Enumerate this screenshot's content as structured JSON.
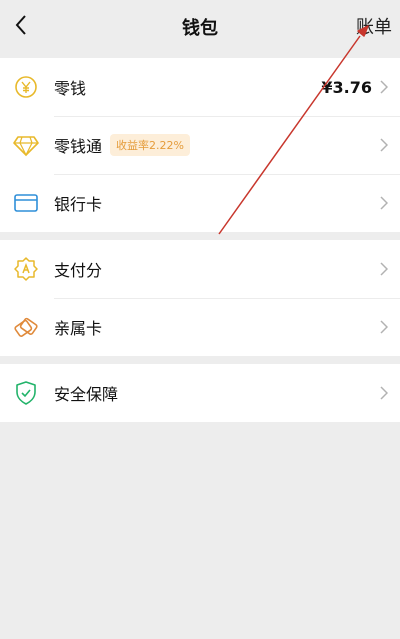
{
  "header": {
    "title": "钱包",
    "bills_label": "账单"
  },
  "sections": [
    {
      "items": [
        {
          "label": "零钱",
          "value": "¥3.76"
        },
        {
          "label": "零钱通",
          "badge": "收益率2.22%"
        },
        {
          "label": "银行卡"
        }
      ]
    },
    {
      "items": [
        {
          "label": "支付分"
        },
        {
          "label": "亲属卡"
        }
      ]
    },
    {
      "items": [
        {
          "label": "安全保障"
        }
      ]
    }
  ],
  "colors": {
    "accent_gold": "#e8b92b",
    "accent_blue": "#2f8fd9",
    "accent_orange": "#e08a3b",
    "accent_green": "#22b36a",
    "annotation_arrow": "#c8372d"
  }
}
